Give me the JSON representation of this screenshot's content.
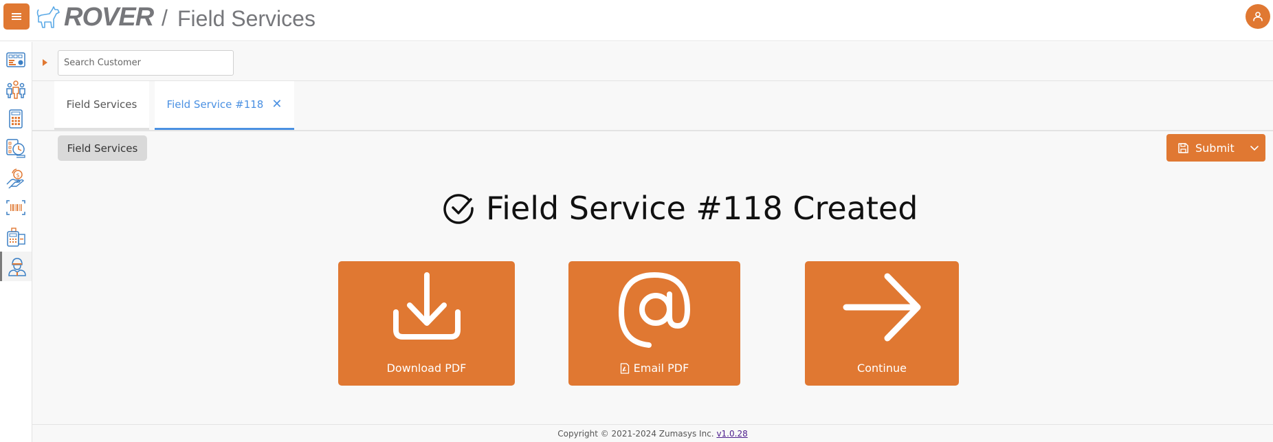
{
  "header": {
    "brand": "ROVER",
    "separator": "/",
    "app_title": "Field Services",
    "menu_icon": "hamburger-icon",
    "user_icon": "user-icon"
  },
  "sidebar": {
    "items": [
      {
        "name": "dashboard",
        "icon": "dashboard-icon",
        "active": false
      },
      {
        "name": "customers",
        "icon": "people-icon",
        "active": false
      },
      {
        "name": "calculator",
        "icon": "calculator-icon",
        "active": false
      },
      {
        "name": "time-tracking",
        "icon": "clock-list-icon",
        "active": false
      },
      {
        "name": "payments",
        "icon": "hand-money-icon",
        "active": false
      },
      {
        "name": "barcode",
        "icon": "barcode-scan-icon",
        "active": false
      },
      {
        "name": "pos-terminal",
        "icon": "card-terminal-icon",
        "active": false
      },
      {
        "name": "field-services",
        "icon": "technician-icon",
        "active": true
      }
    ]
  },
  "search": {
    "placeholder": "Search Customer",
    "value": ""
  },
  "tabs": [
    {
      "label": "Field Services",
      "active": false,
      "closable": false
    },
    {
      "label": "Field Service #118",
      "active": true,
      "closable": true
    }
  ],
  "toolbar": {
    "breadcrumb_label": "Field Services",
    "submit_label": "Submit"
  },
  "main": {
    "heading": "Field Service #118 Created",
    "cards": [
      {
        "label": "Download PDF",
        "icon": "download-icon"
      },
      {
        "label": "Email PDF",
        "icon": "at-sign-icon",
        "label_icon": "pdf-file-icon"
      },
      {
        "label": "Continue",
        "icon": "arrow-right-icon"
      }
    ]
  },
  "footer": {
    "copyright": "Copyright © 2021-2024 Zumasys Inc. ",
    "version": "v1.0.28"
  },
  "colors": {
    "accent": "#e07832",
    "tab_active": "#4a90e2",
    "sidebar_blue": "#3b7fc4"
  }
}
